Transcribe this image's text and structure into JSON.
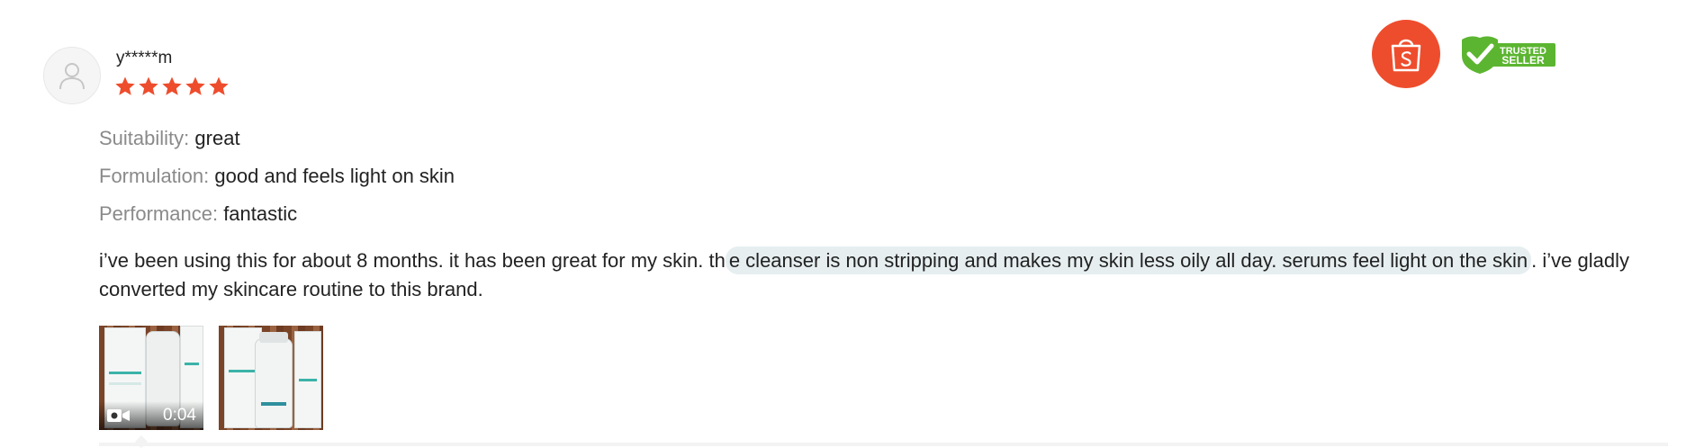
{
  "reviewer": {
    "username": "y*****m",
    "rating": 5
  },
  "attributes": [
    {
      "label": "Suitability:",
      "value": "great"
    },
    {
      "label": "Formulation:",
      "value": "good and feels light on skin"
    },
    {
      "label": "Performance:",
      "value": "fantastic"
    }
  ],
  "review": {
    "text_before": "i’ve been using this for about 8 months. it has been great for my skin. th",
    "text_highlight": "e cleanser is non stripping and makes my skin less oily all day. serums feel light on the skin",
    "text_after": ". i’ve gladly converted my skincare routine to this brand."
  },
  "media": {
    "video_duration": "0:04"
  },
  "badges": {
    "trusted_line1": "TRUSTED",
    "trusted_line2": "SELLER"
  },
  "colors": {
    "star": "#ee4d2d",
    "shop_badge": "#ee4d2d",
    "trusted_green": "#5cb531",
    "highlight": "#e6eef0"
  }
}
